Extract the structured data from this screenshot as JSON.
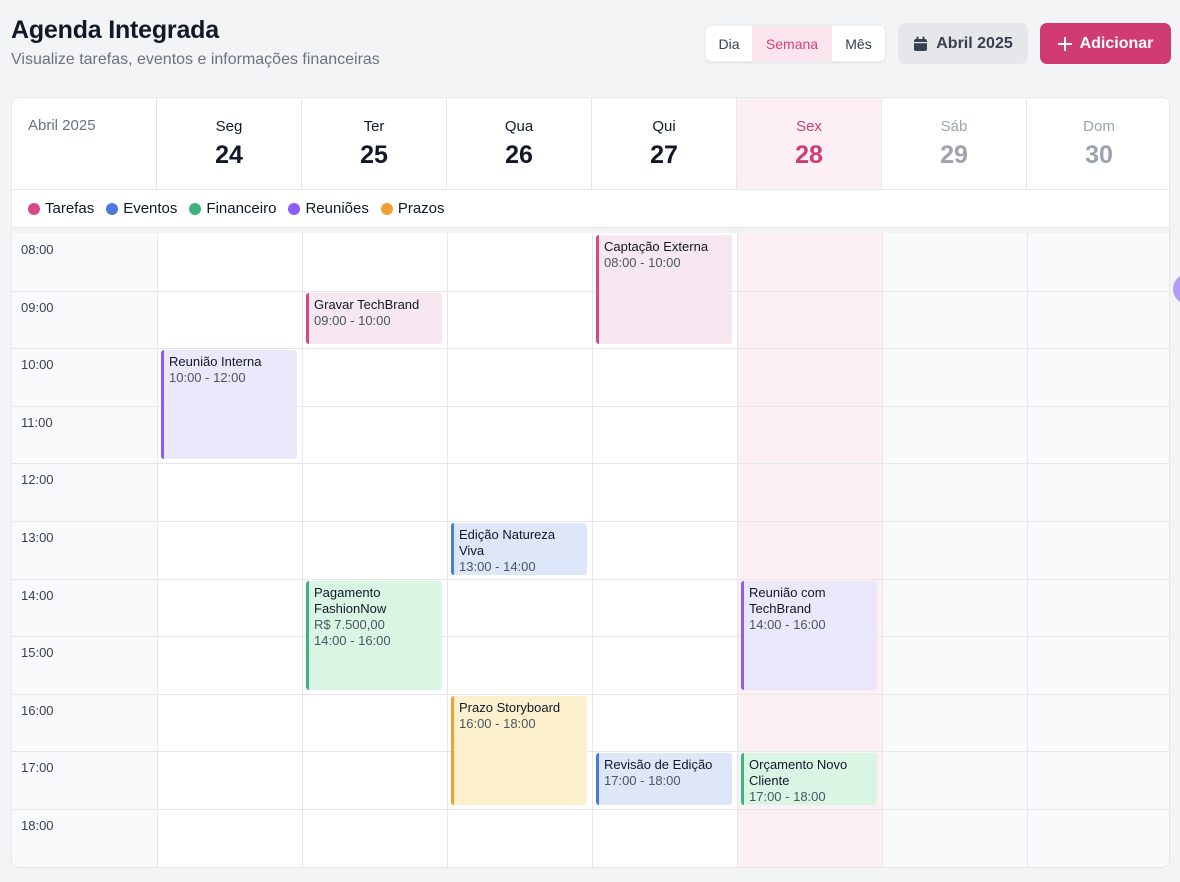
{
  "header": {
    "title": "Agenda Integrada",
    "subtitle": "Visualize tarefas, eventos e informações financeiras"
  },
  "view_toggle": {
    "options": [
      {
        "label": "Dia",
        "active": false
      },
      {
        "label": "Semana",
        "active": true
      },
      {
        "label": "Mês",
        "active": false
      }
    ]
  },
  "month_selector": {
    "label": "Abril 2025",
    "icon": "calendar-icon"
  },
  "add_button": {
    "label": "Adicionar",
    "icon": "plus-icon"
  },
  "calendar": {
    "month_label": "Abril 2025",
    "days": [
      {
        "name": "Seg",
        "number": "24",
        "state": "normal"
      },
      {
        "name": "Ter",
        "number": "25",
        "state": "normal"
      },
      {
        "name": "Qua",
        "number": "26",
        "state": "normal"
      },
      {
        "name": "Qui",
        "number": "27",
        "state": "normal"
      },
      {
        "name": "Sex",
        "number": "28",
        "state": "today"
      },
      {
        "name": "Sáb",
        "number": "29",
        "state": "weekend"
      },
      {
        "name": "Dom",
        "number": "30",
        "state": "weekend"
      }
    ],
    "legend": [
      {
        "label": "Tarefas",
        "color": "#d9478a"
      },
      {
        "label": "Eventos",
        "color": "#4a7be0"
      },
      {
        "label": "Financeiro",
        "color": "#3fb27f"
      },
      {
        "label": "Reuniões",
        "color": "#8b5cf6"
      },
      {
        "label": "Prazos",
        "color": "#f0a030"
      }
    ],
    "hours": [
      "08:00",
      "09:00",
      "10:00",
      "11:00",
      "12:00",
      "13:00",
      "14:00",
      "15:00",
      "16:00",
      "17:00",
      "18:00"
    ],
    "events": [
      {
        "title": "Captação Externa",
        "time": "08:00 - 10:00",
        "extra": "",
        "day": 3,
        "start": 8,
        "end": 10,
        "category": "Tarefas",
        "bg": "#f6e7f0",
        "bar": "#d9478a"
      },
      {
        "title": "Gravar TechBrand",
        "time": "09:00 - 10:00",
        "extra": "",
        "day": 1,
        "start": 9,
        "end": 10,
        "category": "Tarefas",
        "bg": "#f6e7f0",
        "bar": "#d9478a"
      },
      {
        "title": "Reunião Interna",
        "time": "10:00 - 12:00",
        "extra": "",
        "day": 0,
        "start": 10,
        "end": 12,
        "category": "Reuniões",
        "bg": "#ece8fb",
        "bar": "#8b5cf6"
      },
      {
        "title": "Edição Natureza Viva",
        "time": "13:00 - 14:00",
        "extra": "",
        "day": 2,
        "start": 13,
        "end": 14,
        "category": "Eventos",
        "bg": "#dde7f9",
        "bar": "#4a7be0"
      },
      {
        "title": "Pagamento FashionNow",
        "time": "14:00 - 16:00",
        "extra": "R$ 7.500,00",
        "day": 1,
        "start": 14,
        "end": 16,
        "category": "Financeiro",
        "bg": "#d9f6e5",
        "bar": "#3fb27f"
      },
      {
        "title": "Reunião com TechBrand",
        "time": "14:00 - 16:00",
        "extra": "",
        "day": 4,
        "start": 14,
        "end": 16,
        "category": "Reuniões",
        "bg": "#ece8fb",
        "bar": "#8b5cf6"
      },
      {
        "title": "Prazo Storyboard",
        "time": "16:00 - 18:00",
        "extra": "",
        "day": 2,
        "start": 16,
        "end": 18,
        "category": "Prazos",
        "bg": "#fcf1cc",
        "bar": "#f0a030"
      },
      {
        "title": "Revisão de Edição",
        "time": "17:00 - 18:00",
        "extra": "",
        "day": 3,
        "start": 17,
        "end": 18,
        "category": "Eventos",
        "bg": "#dde7f9",
        "bar": "#4a7be0"
      },
      {
        "title": "Orçamento Novo Cliente",
        "time": "17:00 - 18:00",
        "extra": "",
        "day": 4,
        "start": 17,
        "end": 18,
        "category": "Financeiro",
        "bg": "#d9f6e5",
        "bar": "#3fb27f"
      }
    ]
  }
}
